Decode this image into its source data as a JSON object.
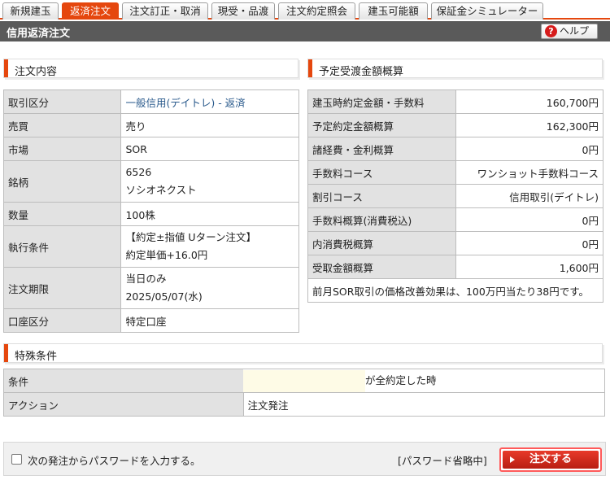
{
  "tabs": [
    {
      "label": "新規建玉",
      "active": false
    },
    {
      "label": "返済注文",
      "active": true
    },
    {
      "label": "注文訂正・取消",
      "active": false
    },
    {
      "label": "現受・品渡",
      "active": false
    },
    {
      "label": "注文約定照会",
      "active": false
    },
    {
      "label": "建玉可能額",
      "active": false
    },
    {
      "label": "保証金シミュレーター",
      "active": false
    }
  ],
  "header": {
    "title": "信用返済注文",
    "help_label": "ヘルプ",
    "help_icon": "question-circle-icon"
  },
  "order_section": {
    "title": "注文内容",
    "rows": [
      {
        "label": "取引区分",
        "value": "一般信用(デイトレ) - 返済"
      },
      {
        "label": "売買",
        "value": "売り"
      },
      {
        "label": "市場",
        "value": "SOR"
      },
      {
        "label": "銘柄",
        "lines": [
          "6526",
          "ソシオネクスト"
        ]
      },
      {
        "label": "数量",
        "value": "100株"
      },
      {
        "label": "執行条件",
        "lines": [
          "【約定±指値 Uターン注文】",
          "約定単価+16.0円"
        ]
      },
      {
        "label": "注文期限",
        "lines": [
          "当日のみ",
          "2025/05/07(水)"
        ]
      },
      {
        "label": "口座区分",
        "value": "特定口座"
      }
    ]
  },
  "estimate_section": {
    "title": "予定受渡金額概算",
    "rows": [
      {
        "label": "建玉時約定金額・手数料",
        "value": "160,700円"
      },
      {
        "label": "予定約定金額概算",
        "value": "162,300円"
      },
      {
        "label": "諸経費・金利概算",
        "value": "0円"
      },
      {
        "label": "手数料コース",
        "value": "ワンショット手数料コース"
      },
      {
        "label": "割引コース",
        "value": "信用取引(デイトレ)"
      },
      {
        "label": "手数料概算(消費税込)",
        "value": "0円"
      },
      {
        "label": "内消費税概算",
        "value": "0円"
      },
      {
        "label": "受取金額概算",
        "value": "1,600円"
      }
    ],
    "note": "前月SOR取引の価格改善効果は、100万円当たり38円です。"
  },
  "special_section": {
    "title": "特殊条件",
    "rows": [
      {
        "label": "条件",
        "value": "が全約定した時"
      },
      {
        "label": "アクション",
        "value": "注文発注"
      }
    ]
  },
  "footer": {
    "checkbox_label": "次の発注からパスワードを入力する。",
    "password_status": "[パスワード省略中]",
    "order_button": "注文する"
  },
  "colors": {
    "accent": "#e5470e",
    "header_bg": "#5a5a5a",
    "label_bg": "#e2e2e2",
    "link_blue": "#2a5a8c",
    "order_button": "#d0281a"
  }
}
